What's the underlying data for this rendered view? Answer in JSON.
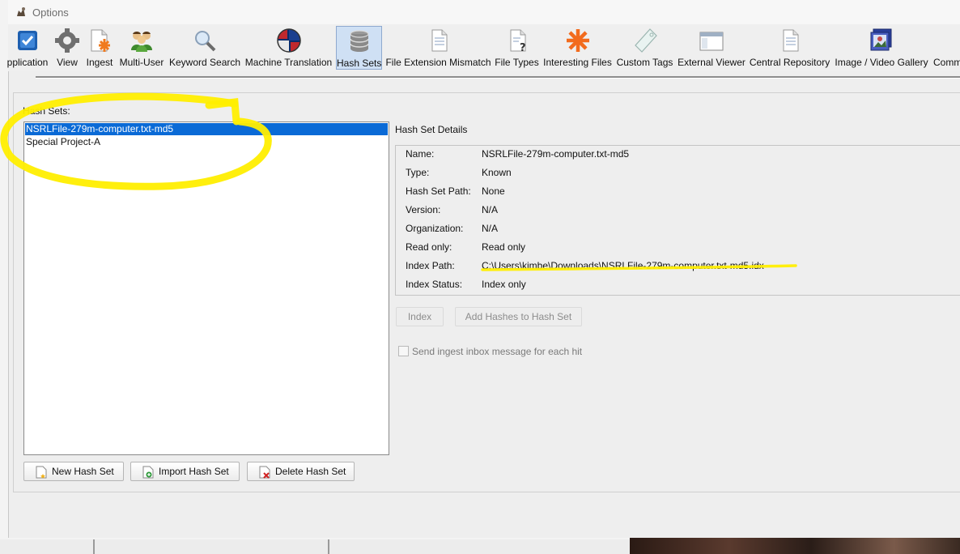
{
  "window": {
    "title": "Options"
  },
  "toolbar": {
    "items": [
      {
        "label": "pplication",
        "icon": "checkbox-icon"
      },
      {
        "label": "View",
        "icon": "gear-icon"
      },
      {
        "label": "Ingest",
        "icon": "ingest-icon"
      },
      {
        "label": "Multi-User",
        "icon": "users-icon"
      },
      {
        "label": "Keyword Search",
        "icon": "magnifier-icon"
      },
      {
        "label": "Machine Translation",
        "icon": "globe-flags-icon"
      },
      {
        "label": "Hash Sets",
        "icon": "database-icon",
        "selected": true
      },
      {
        "label": "File Extension Mismatch",
        "icon": "document-icon"
      },
      {
        "label": "File Types",
        "icon": "document-question-icon"
      },
      {
        "label": "Interesting Files",
        "icon": "asterisk-icon"
      },
      {
        "label": "Custom Tags",
        "icon": "tag-icon"
      },
      {
        "label": "External Viewer",
        "icon": "window-icon"
      },
      {
        "label": "Central Repository",
        "icon": "document-icon"
      },
      {
        "label": "Image / Video Gallery",
        "icon": "gallery-icon"
      },
      {
        "label": "Comm",
        "icon": "comm-icon"
      }
    ]
  },
  "hash_sets": {
    "label": "Hash Sets:",
    "items": [
      {
        "name": "NSRLFile-279m-computer.txt-md5",
        "selected": true
      },
      {
        "name": "Special Project-A",
        "selected": false
      }
    ],
    "buttons": {
      "new": "New Hash Set",
      "import": "Import Hash Set",
      "delete": "Delete Hash Set"
    }
  },
  "details": {
    "title": "Hash Set Details",
    "rows": [
      {
        "key": "Name:",
        "value": "NSRLFile-279m-computer.txt-md5"
      },
      {
        "key": "Type:",
        "value": "Known"
      },
      {
        "key": "Hash Set Path:",
        "value": "None"
      },
      {
        "key": "Version:",
        "value": "N/A"
      },
      {
        "key": "Organization:",
        "value": "N/A"
      },
      {
        "key": "Read only:",
        "value": "Read only"
      },
      {
        "key": "Index Path:",
        "value": "C:\\Users\\kimbe\\Downloads\\NSRLFile-279m-computer.txt-md5.idx"
      },
      {
        "key": "Index Status:",
        "value": "Index only"
      }
    ],
    "buttons": {
      "index": "Index",
      "add_hashes": "Add Hashes to Hash Set"
    },
    "checkbox": {
      "label": "Send ingest inbox message for each hit",
      "checked": false
    }
  },
  "colors": {
    "selection": "#0a6ad6",
    "highlight": "#ffee00",
    "toolbar_selected": "#cfe0f4"
  }
}
